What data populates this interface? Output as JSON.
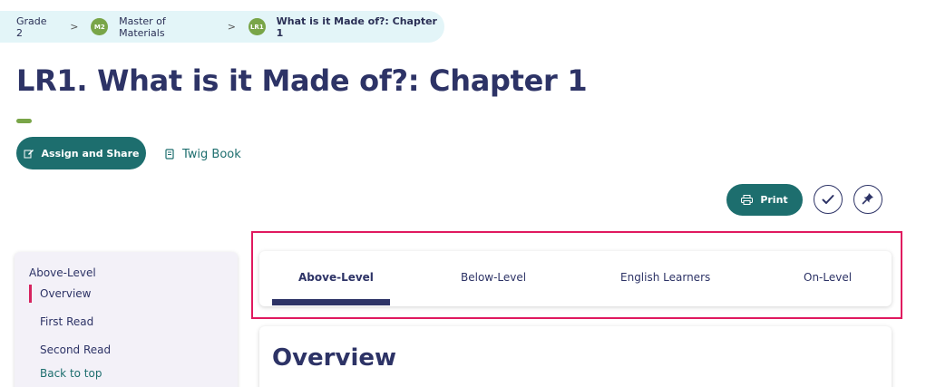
{
  "breadcrumb": {
    "grade": "Grade 2",
    "module_badge": "M2",
    "module": "Master of Materials",
    "lesson_badge": "LR1",
    "lesson": "What is it Made of?: Chapter 1"
  },
  "page": {
    "title": "LR1. What is it Made of?: Chapter 1"
  },
  "actions": {
    "assign_label": "Assign and Share",
    "twig_label": "Twig Book",
    "print_label": "Print"
  },
  "sidebar": {
    "heading": "Above-Level",
    "items": [
      {
        "label": "Overview",
        "active": true
      },
      {
        "label": "First Read"
      },
      {
        "label": "Second Read"
      }
    ],
    "back_to_top": "Back to top"
  },
  "tabs": [
    {
      "label": "Above-Level",
      "active": true
    },
    {
      "label": "Below-Level"
    },
    {
      "label": "English Learners"
    },
    {
      "label": "On-Level"
    }
  ],
  "overview": {
    "title": "Overview"
  },
  "colors": {
    "primary": "#1d6e6e",
    "navy": "#2d3366",
    "green": "#79a548",
    "highlight": "#e0195f",
    "breadcrumb_bg": "#e3f5f8"
  }
}
